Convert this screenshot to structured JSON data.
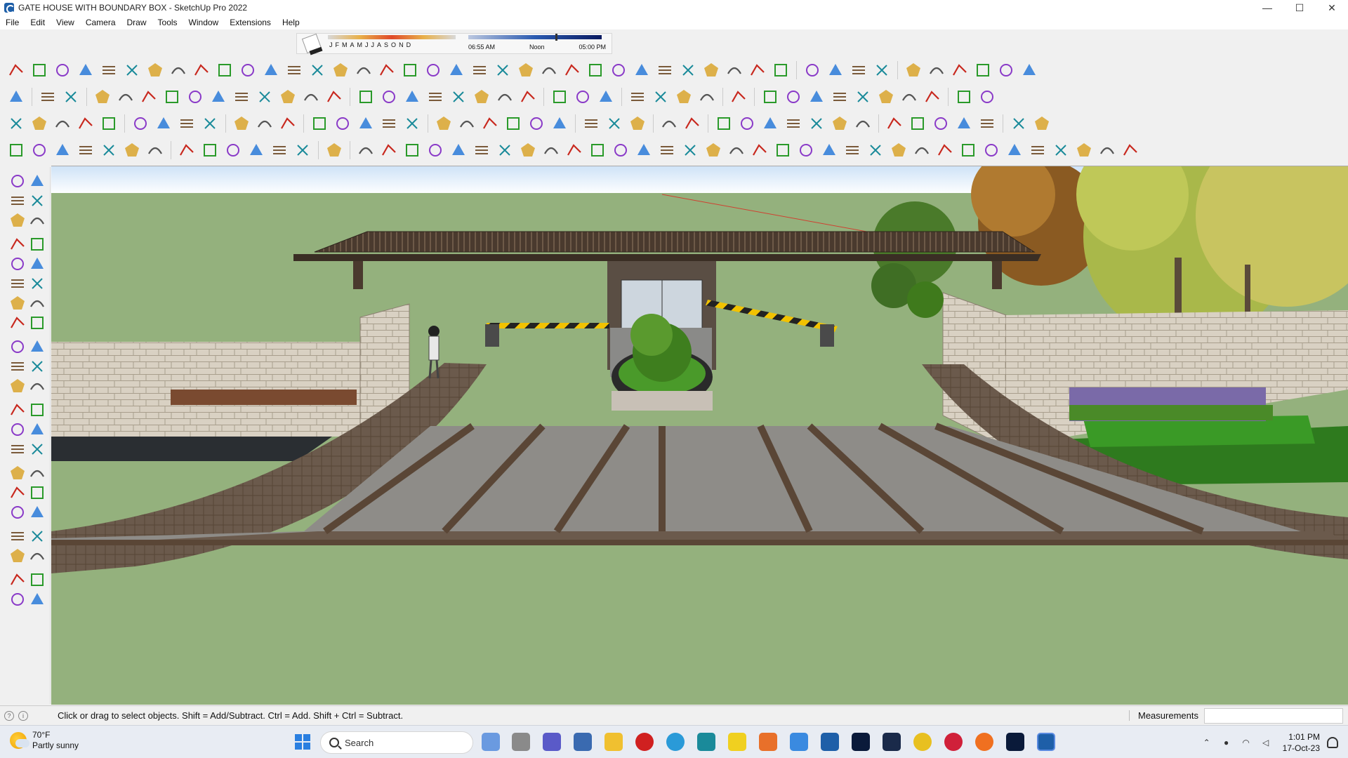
{
  "window": {
    "title": "GATE HOUSE WITH BOUNDARY BOX - SketchUp Pro 2022",
    "controls": {
      "minimize": "—",
      "maximize": "☐",
      "close": "✕"
    }
  },
  "menu": [
    "File",
    "Edit",
    "View",
    "Camera",
    "Draw",
    "Tools",
    "Window",
    "Extensions",
    "Help"
  ],
  "shadows": {
    "months": [
      "J",
      "F",
      "M",
      "A",
      "M",
      "J",
      "J",
      "A",
      "S",
      "O",
      "N",
      "D"
    ],
    "time_start": "06:55 AM",
    "time_noon": "Noon",
    "time_end": "05:00 PM",
    "time_position": 0.65
  },
  "status": {
    "hint": "Click or drag to select objects. Shift = Add/Subtract. Ctrl = Add. Shift + Ctrl = Subtract.",
    "measurements_label": "Measurements",
    "measurements_value": ""
  },
  "taskbar": {
    "weather_temp": "70°F",
    "weather_desc": "Partly sunny",
    "search_label": "Search",
    "time": "1:01 PM",
    "date": "17-Oct-23"
  },
  "colors": {
    "sky": "#ffffff",
    "ground": "#94b17d",
    "roof": "#5a4638",
    "wall": "#d8d0c2",
    "paving": "#8e8c88",
    "accent_red": "#c8281e",
    "accent_green": "#2a9a2a"
  }
}
